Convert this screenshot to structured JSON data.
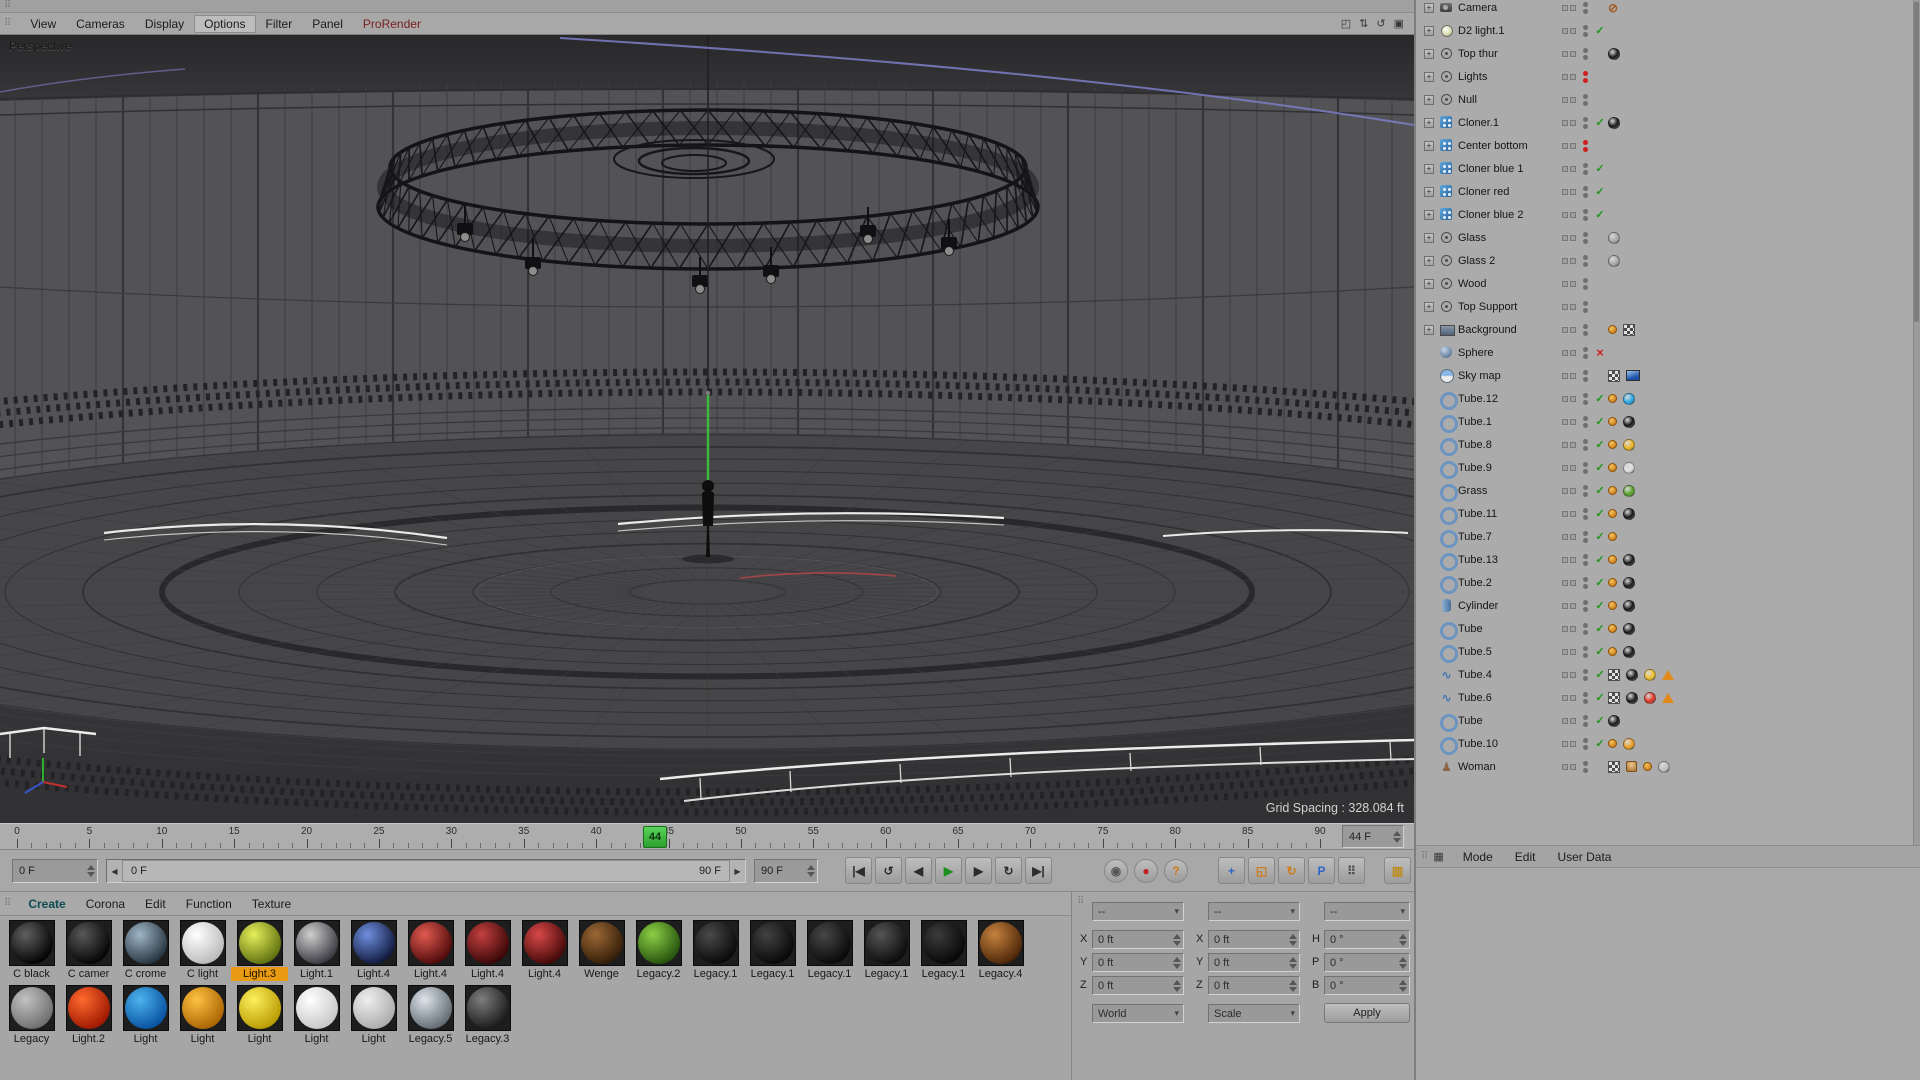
{
  "icons": {
    "grip": "⠿",
    "panel_grid": "▦"
  },
  "viewport_menu": {
    "items": [
      {
        "label": "View"
      },
      {
        "label": "Cameras"
      },
      {
        "label": "Display"
      },
      {
        "label": "Options",
        "state": "active"
      },
      {
        "label": "Filter"
      },
      {
        "label": "Panel"
      },
      {
        "label": "ProRender",
        "state": "accent"
      }
    ],
    "corner_icons": [
      {
        "name": "viewport-move-icon",
        "glyph": "◰"
      },
      {
        "name": "viewport-swap-icon",
        "glyph": "⇅"
      },
      {
        "name": "viewport-undo-icon",
        "glyph": "↺"
      },
      {
        "name": "viewport-toggle-icon",
        "glyph": "▣"
      }
    ]
  },
  "viewport": {
    "camera_label": "Perspective",
    "grid_spacing": "Grid Spacing : 328.084 ft"
  },
  "timeline": {
    "frame_start": 0,
    "frame_end": 90,
    "current_frame": 44,
    "ticks": [
      0,
      5,
      10,
      15,
      20,
      25,
      30,
      35,
      40,
      45,
      50,
      55,
      60,
      65,
      70,
      75,
      80,
      85,
      90
    ]
  },
  "transport": {
    "fields": {
      "start": "0 F",
      "end": "90 F",
      "current": "44 F",
      "slider_left": "0 F",
      "slider_right": "90 F"
    },
    "playback": [
      {
        "name": "goto-start-button",
        "glyph": "|◀"
      },
      {
        "name": "play-reverse-button",
        "glyph": "↺"
      },
      {
        "name": "step-back-button",
        "glyph": "◀"
      },
      {
        "name": "play-button",
        "glyph": "▶",
        "color": "#1e8e1e"
      },
      {
        "name": "step-forward-button",
        "glyph": "▶"
      },
      {
        "name": "play-loop-button",
        "glyph": "↻"
      },
      {
        "name": "goto-end-button",
        "glyph": "▶|"
      }
    ],
    "record": [
      {
        "name": "keyframe-button",
        "glyph": "◉",
        "color": "#575757"
      },
      {
        "name": "record-button",
        "glyph": "●",
        "color": "#c22020"
      },
      {
        "name": "autokey-help-button",
        "glyph": "?",
        "color": "#d07a18"
      }
    ],
    "key_filters": [
      {
        "name": "key-position-button",
        "glyph": "+",
        "color": "#2f66c8"
      },
      {
        "name": "key-scale-button",
        "glyph": "◱",
        "color": "#d07a18"
      },
      {
        "name": "key-rotation-button",
        "glyph": "↻",
        "color": "#d07a18"
      },
      {
        "name": "key-parameter-button",
        "glyph": "P",
        "color": "#2f66c8"
      },
      {
        "name": "key-pla-button",
        "glyph": "⠿",
        "color": "#4a4a4a"
      }
    ],
    "layout_button": {
      "name": "timeline-layout-button",
      "glyph": "▥",
      "color": "#c08a14"
    }
  },
  "materials": {
    "tabs": [
      {
        "label": "Create",
        "accent": true
      },
      {
        "label": "Corona"
      },
      {
        "label": "Edit"
      },
      {
        "label": "Function"
      },
      {
        "label": "Texture"
      }
    ],
    "row1": [
      {
        "label": "C black",
        "hi": "#606060",
        "lo": "#000000"
      },
      {
        "label": "C camer",
        "hi": "#585858",
        "lo": "#020202"
      },
      {
        "label": "C crome",
        "hi": "#9fb6c6",
        "lo": "#24323e"
      },
      {
        "label": "C light",
        "hi": "#ffffff",
        "lo": "#b9b9b9"
      },
      {
        "label": "Light.3",
        "hi": "#e6ee5a",
        "lo": "#5c6e0e",
        "selected": true
      },
      {
        "label": "Light.1",
        "hi": "#cfcfcf",
        "lo": "#35353d"
      },
      {
        "label": "Light.4",
        "hi": "#6f8fdf",
        "lo": "#0e1638"
      },
      {
        "label": "Light.4",
        "hi": "#e05a50",
        "lo": "#4a0808"
      },
      {
        "label": "Light.4",
        "hi": "#c44040",
        "lo": "#360505"
      },
      {
        "label": "Light.4",
        "hi": "#d84848",
        "lo": "#400707"
      },
      {
        "label": "Wenge",
        "hi": "#9a6836",
        "lo": "#311b06"
      },
      {
        "label": "Legacy.2",
        "hi": "#8ccf46",
        "lo": "#234f0c"
      },
      {
        "label": "Legacy.1",
        "hi": "#4a4a4a",
        "lo": "#070707"
      },
      {
        "label": "Legacy.1",
        "hi": "#424242",
        "lo": "#060606"
      },
      {
        "label": "Legacy.1",
        "hi": "#474747",
        "lo": "#070707"
      },
      {
        "label": "Legacy.1",
        "hi": "#555555",
        "lo": "#090909"
      },
      {
        "label": "Legacy.1",
        "hi": "#3c3c3c",
        "lo": "#050505"
      },
      {
        "label": "Legacy.4",
        "hi": "#c4813f",
        "lo": "#4a2406"
      }
    ],
    "row2": [
      {
        "label": "Legacy",
        "hi": "#c2c2c2",
        "lo": "#6c6c6c"
      },
      {
        "label": "Light.2",
        "hi": "#ff6a2e",
        "lo": "#9c1600"
      },
      {
        "label": "Light",
        "hi": "#4cb4ee",
        "lo": "#074f9e"
      },
      {
        "label": "Light",
        "hi": "#ffc243",
        "lo": "#a86200"
      },
      {
        "label": "Light",
        "hi": "#fdef5e",
        "lo": "#b89a00"
      },
      {
        "label": "Light",
        "hi": "#ffffff",
        "lo": "#c6c6c6"
      },
      {
        "label": "Light",
        "hi": "#eeeeee",
        "lo": "#ababab"
      },
      {
        "label": "Legacy.5",
        "hi": "#dde4ea",
        "lo": "#5f6870"
      },
      {
        "label": "Legacy.3",
        "hi": "#7e7e7e",
        "lo": "#161616"
      }
    ]
  },
  "coords": {
    "headers": [
      "--",
      "--",
      "--"
    ],
    "rows": [
      {
        "a": "X",
        "av": "0 ft",
        "b": "X",
        "bv": "0 ft",
        "c": "H",
        "cv": "0 °"
      },
      {
        "a": "Y",
        "av": "0 ft",
        "b": "Y",
        "bv": "0 ft",
        "c": "P",
        "cv": "0 °"
      },
      {
        "a": "Z",
        "av": "0 ft",
        "b": "Z",
        "bv": "0 ft",
        "c": "B",
        "cv": "0 °"
      }
    ],
    "space": "World",
    "mode": "Scale",
    "apply": "Apply"
  },
  "objects": {
    "rows": [
      {
        "name": "Camera",
        "icon": "camera",
        "expand": true,
        "dots": "gray",
        "mark": "",
        "tags": [
          "protect"
        ]
      },
      {
        "name": "D2 light.1",
        "icon": "light",
        "expand": true,
        "dots": "gray",
        "mark": "check",
        "tags": []
      },
      {
        "name": "Top thur",
        "icon": "group",
        "expand": true,
        "dots": "gray",
        "mark": "",
        "tags": [
          "sphere:#181818"
        ]
      },
      {
        "name": "Lights",
        "icon": "group",
        "expand": true,
        "dots": "red",
        "mark": "",
        "tags": []
      },
      {
        "name": "Null",
        "icon": "group",
        "expand": true,
        "dots": "gray",
        "mark": "",
        "tags": []
      },
      {
        "name": "Cloner.1",
        "icon": "cloner",
        "expand": true,
        "dots": "gray",
        "mark": "check",
        "tags": [
          "sphere:#181818"
        ]
      },
      {
        "name": "Center bottom",
        "icon": "cloner",
        "expand": true,
        "dots": "red",
        "mark": "",
        "tags": []
      },
      {
        "name": "Cloner blue 1",
        "icon": "cloner",
        "expand": true,
        "dots": "gray",
        "mark": "check",
        "tags": []
      },
      {
        "name": "Cloner red",
        "icon": "cloner",
        "expand": true,
        "dots": "gray",
        "mark": "check",
        "tags": []
      },
      {
        "name": "Cloner blue 2",
        "icon": "cloner",
        "expand": true,
        "dots": "gray",
        "mark": "check",
        "tags": []
      },
      {
        "name": "Glass",
        "icon": "group",
        "expand": true,
        "dots": "gray",
        "mark": "",
        "tags": [
          "sphere:#a8a8a8"
        ]
      },
      {
        "name": "Glass 2",
        "icon": "group",
        "expand": true,
        "dots": "gray",
        "mark": "",
        "tags": [
          "sphere:#a8a8a8"
        ]
      },
      {
        "name": "Wood",
        "icon": "group",
        "expand": true,
        "dots": "gray",
        "mark": "",
        "tags": []
      },
      {
        "name": "Top Support",
        "icon": "group",
        "expand": true,
        "dots": "gray",
        "mark": "",
        "tags": []
      },
      {
        "name": "Background",
        "icon": "background",
        "expand": true,
        "dots": "gray",
        "mark": "",
        "tags": [
          "orange-dot",
          "checker"
        ]
      },
      {
        "name": "Sphere",
        "icon": "sphere",
        "expand": false,
        "dots": "gray",
        "mark": "cross",
        "tags": []
      },
      {
        "name": "Sky map",
        "icon": "sky",
        "expand": false,
        "dots": "gray",
        "mark": "",
        "tags": [
          "checker",
          "image:#1c50a8"
        ]
      },
      {
        "name": "Tube.12",
        "icon": "tube",
        "expand": false,
        "dots": "gray",
        "mark": "check",
        "tags": [
          "orange-dot",
          "sphere:#28aae8"
        ]
      },
      {
        "name": "Tube.1",
        "icon": "tube",
        "expand": false,
        "dots": "gray",
        "mark": "check",
        "tags": [
          "orange-dot",
          "sphere:#181818"
        ]
      },
      {
        "name": "Tube.8",
        "icon": "tube",
        "expand": false,
        "dots": "gray",
        "mark": "check",
        "tags": [
          "orange-dot",
          "sphere:#f0b420"
        ]
      },
      {
        "name": "Tube.9",
        "icon": "tube",
        "expand": false,
        "dots": "gray",
        "mark": "check",
        "tags": [
          "orange-dot",
          "sphere:#e0e0e0"
        ]
      },
      {
        "name": "Grass",
        "icon": "tube",
        "expand": false,
        "dots": "gray",
        "mark": "check",
        "tags": [
          "orange-dot",
          "sphere:#58a428"
        ]
      },
      {
        "name": "Tube.11",
        "icon": "tube",
        "expand": false,
        "dots": "gray",
        "mark": "check",
        "tags": [
          "orange-dot",
          "sphere:#181818"
        ]
      },
      {
        "name": "Tube.7",
        "icon": "tube",
        "expand": false,
        "dots": "gray",
        "mark": "check",
        "tags": [
          "orange-dot"
        ]
      },
      {
        "name": "Tube.13",
        "icon": "tube",
        "expand": false,
        "dots": "gray",
        "mark": "check",
        "tags": [
          "orange-dot",
          "sphere:#181818"
        ]
      },
      {
        "name": "Tube.2",
        "icon": "tube",
        "expand": false,
        "dots": "gray",
        "mark": "check",
        "tags": [
          "orange-dot",
          "sphere:#181818"
        ]
      },
      {
        "name": "Cylinder",
        "icon": "cylinder",
        "expand": false,
        "dots": "gray",
        "mark": "check",
        "tags": [
          "orange-dot",
          "sphere:#181818"
        ]
      },
      {
        "name": "Tube",
        "icon": "tube",
        "expand": false,
        "dots": "gray",
        "mark": "check",
        "tags": [
          "orange-dot",
          "sphere:#181818"
        ]
      },
      {
        "name": "Tube.5",
        "icon": "tube",
        "expand": false,
        "dots": "gray",
        "mark": "check",
        "tags": [
          "orange-dot",
          "sphere:#181818"
        ]
      },
      {
        "name": "Tube.4",
        "icon": "spline",
        "expand": false,
        "dots": "gray",
        "mark": "check",
        "tags": [
          "checker",
          "sphere:#181818",
          "sphere:#f0c028",
          "warn"
        ]
      },
      {
        "name": "Tube.6",
        "icon": "spline",
        "expand": false,
        "dots": "gray",
        "mark": "check",
        "tags": [
          "checker",
          "sphere:#181818",
          "sphere:#e23420",
          "warn"
        ]
      },
      {
        "name": "Tube",
        "icon": "tube",
        "expand": false,
        "dots": "gray",
        "mark": "check",
        "tags": [
          "sphere:#181818"
        ]
      },
      {
        "name": "Tube.10",
        "icon": "tube",
        "expand": false,
        "dots": "gray",
        "mark": "check",
        "tags": [
          "orange-dot",
          "sphere:#f0a020"
        ]
      },
      {
        "name": "Woman",
        "icon": "figure",
        "expand": false,
        "dots": "gray",
        "mark": "",
        "tags": [
          "checker",
          "pose",
          "orange-dot",
          "sphere:#c0c0c0"
        ]
      }
    ]
  },
  "right_bar": {
    "items": [
      "Mode",
      "Edit",
      "User Data"
    ]
  }
}
